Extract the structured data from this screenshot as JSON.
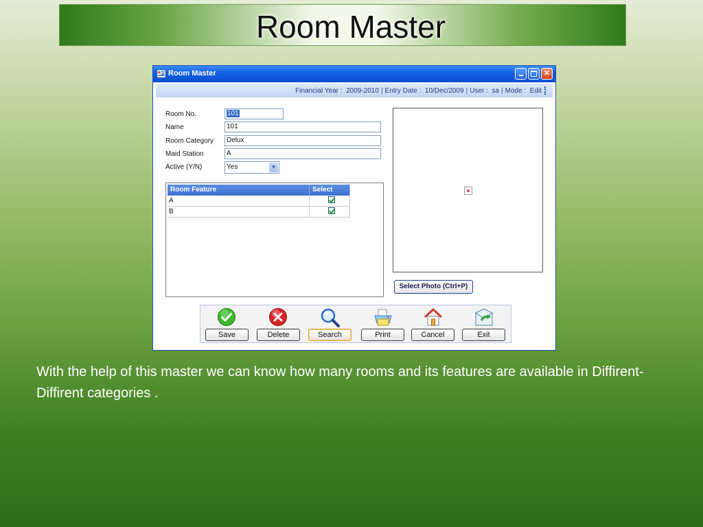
{
  "slide": {
    "title": "Room Master",
    "caption": "With the help of this master we can know  how many rooms  and its features  are available  in  Diffirent-Diffirent categories ."
  },
  "window": {
    "title": "Room Master",
    "controls": [
      "minimize",
      "maximize",
      "close"
    ]
  },
  "status": {
    "financial_year": "Financial Year :  2009-2010",
    "entry_date": "Entry Date :  10/Dec/2009",
    "user": "User :  sa",
    "mode": "Mode :  Edit"
  },
  "form": {
    "room_no_label": "Room No.",
    "room_no_value": "101",
    "name_label": "Name",
    "name_value": "101",
    "category_label": "Room Category",
    "category_value": "Delux",
    "maid_label": "Maid Station",
    "maid_value": "A",
    "active_label": "Active (Y/N)",
    "active_value": "Yes"
  },
  "grid": {
    "headers": [
      "Room Feature",
      "Select"
    ],
    "rows": [
      {
        "feature": "A",
        "selected": true
      },
      {
        "feature": "B",
        "selected": true
      }
    ]
  },
  "photo": {
    "button_label": "Select Photo (Ctrl+P)",
    "icon": "broken-image-icon"
  },
  "toolbar": {
    "save_label": "Save",
    "delete_label": "Delete",
    "search_label": "Search",
    "print_label": "Print",
    "cancel_label": "Cancel",
    "exit_label": "Exit"
  },
  "colors": {
    "titlebar": "#0f5fe0",
    "grid_header": "#3d6fcf",
    "save_green": "#3fb72f",
    "delete_red": "#d8262a"
  }
}
